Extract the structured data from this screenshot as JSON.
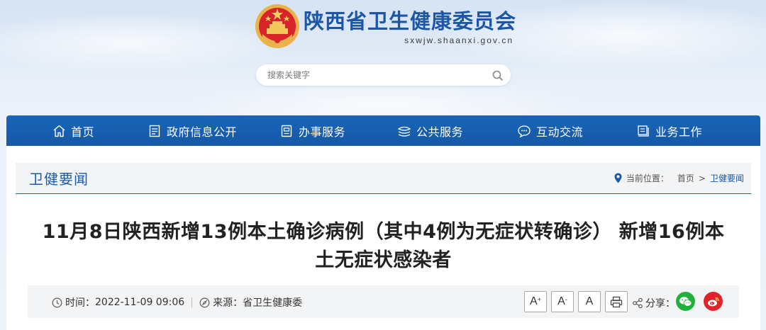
{
  "header": {
    "site_name": "陕西省卫生健康委员会",
    "domain": "sxwjw.shaanxi.gov.cn",
    "emblem_icon": "national-emblem-icon"
  },
  "search": {
    "placeholder": "搜索关键字",
    "icon": "search-icon"
  },
  "nav": {
    "items": [
      {
        "label": "首页",
        "icon": "home-icon"
      },
      {
        "label": "政府信息公开",
        "icon": "document-list-icon"
      },
      {
        "label": "办事服务",
        "icon": "file-icon"
      },
      {
        "label": "公共服务",
        "icon": "layers-icon"
      },
      {
        "label": "互动交流",
        "icon": "chat-icon"
      },
      {
        "label": "业务工作",
        "icon": "archive-icon"
      }
    ]
  },
  "section": {
    "title": "卫健要闻",
    "location_label": "当前位置：",
    "breadcrumb": [
      "首页",
      "卫健要闻"
    ],
    "separator": ">"
  },
  "article": {
    "title": "11月8日陕西新增13例本土确诊病例（其中4例为无症状转确诊） 新增16例本土无症状感染者",
    "time_label": "时间：",
    "time_value": "2022-11-09 09:06",
    "source_label": "来源：",
    "source_value": "省卫生健康委"
  },
  "toolbar": {
    "font_increase": "A",
    "font_increase_mark": "+",
    "font_decrease": "A",
    "font_decrease_mark": "-",
    "font_default": "A",
    "print_icon": "print-icon",
    "share_label": "分享：",
    "share_icon": "share-icon",
    "wechat_icon": "wechat-icon",
    "weibo_icon": "weibo-icon"
  },
  "colors": {
    "brand_blue": "#1b56a8",
    "nav_blue": "#1558a6",
    "wechat_green": "#21b03a",
    "weibo_red": "#e0242c"
  }
}
